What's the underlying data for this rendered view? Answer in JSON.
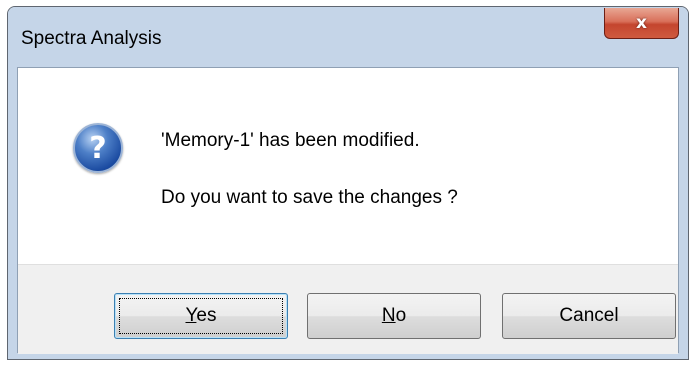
{
  "window": {
    "title": "Spectra Analysis",
    "close_glyph": "x",
    "close_icon": "close-icon"
  },
  "message": {
    "icon": "question-icon",
    "icon_glyph": "?",
    "line1": "'Memory-1' has been modified.",
    "line2": "Do you want to save the changes ?"
  },
  "buttons": {
    "yes": {
      "mnemonic": "Y",
      "rest": "es",
      "focused": true
    },
    "no": {
      "mnemonic": "N",
      "rest": "o"
    },
    "cancel": {
      "label": "Cancel"
    }
  },
  "colors": {
    "title_bar": "#c5d5e8",
    "close_button": "#c4452e",
    "footer": "#f0f0f0",
    "question_icon": "#1a4aa0"
  }
}
